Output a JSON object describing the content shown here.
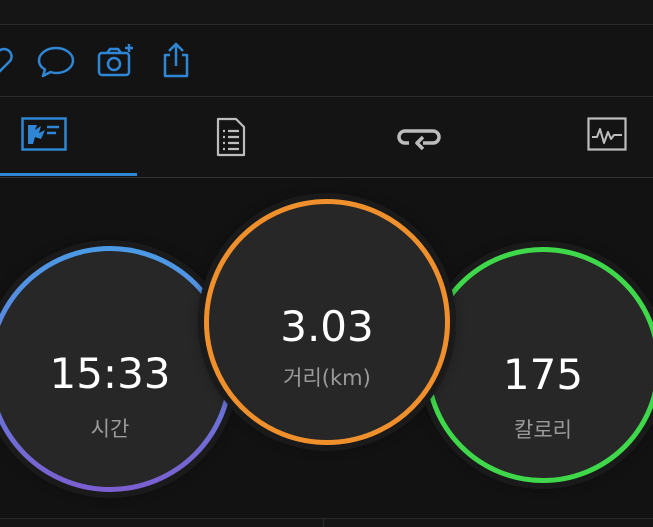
{
  "colors": {
    "accent": "#2f86d4",
    "time_ring_start": "#4b9be6",
    "time_ring_end": "#7b5fd0",
    "distance_ring": "#f0902c",
    "calories_ring": "#3ed84a"
  },
  "toolbar": {
    "icons": [
      "heart-icon",
      "comment-icon",
      "add-photo-icon",
      "share-icon"
    ]
  },
  "tabs": [
    {
      "icon": "stats-icon",
      "selected": true
    },
    {
      "icon": "details-icon",
      "selected": false
    },
    {
      "icon": "laps-icon",
      "selected": false
    },
    {
      "icon": "chart-icon",
      "selected": false
    }
  ],
  "metrics": {
    "time": {
      "value": "15:33",
      "label": "시간"
    },
    "distance": {
      "value": "3.03",
      "label": "거리(km)"
    },
    "calories": {
      "value": "175",
      "label": "칼로리"
    }
  }
}
